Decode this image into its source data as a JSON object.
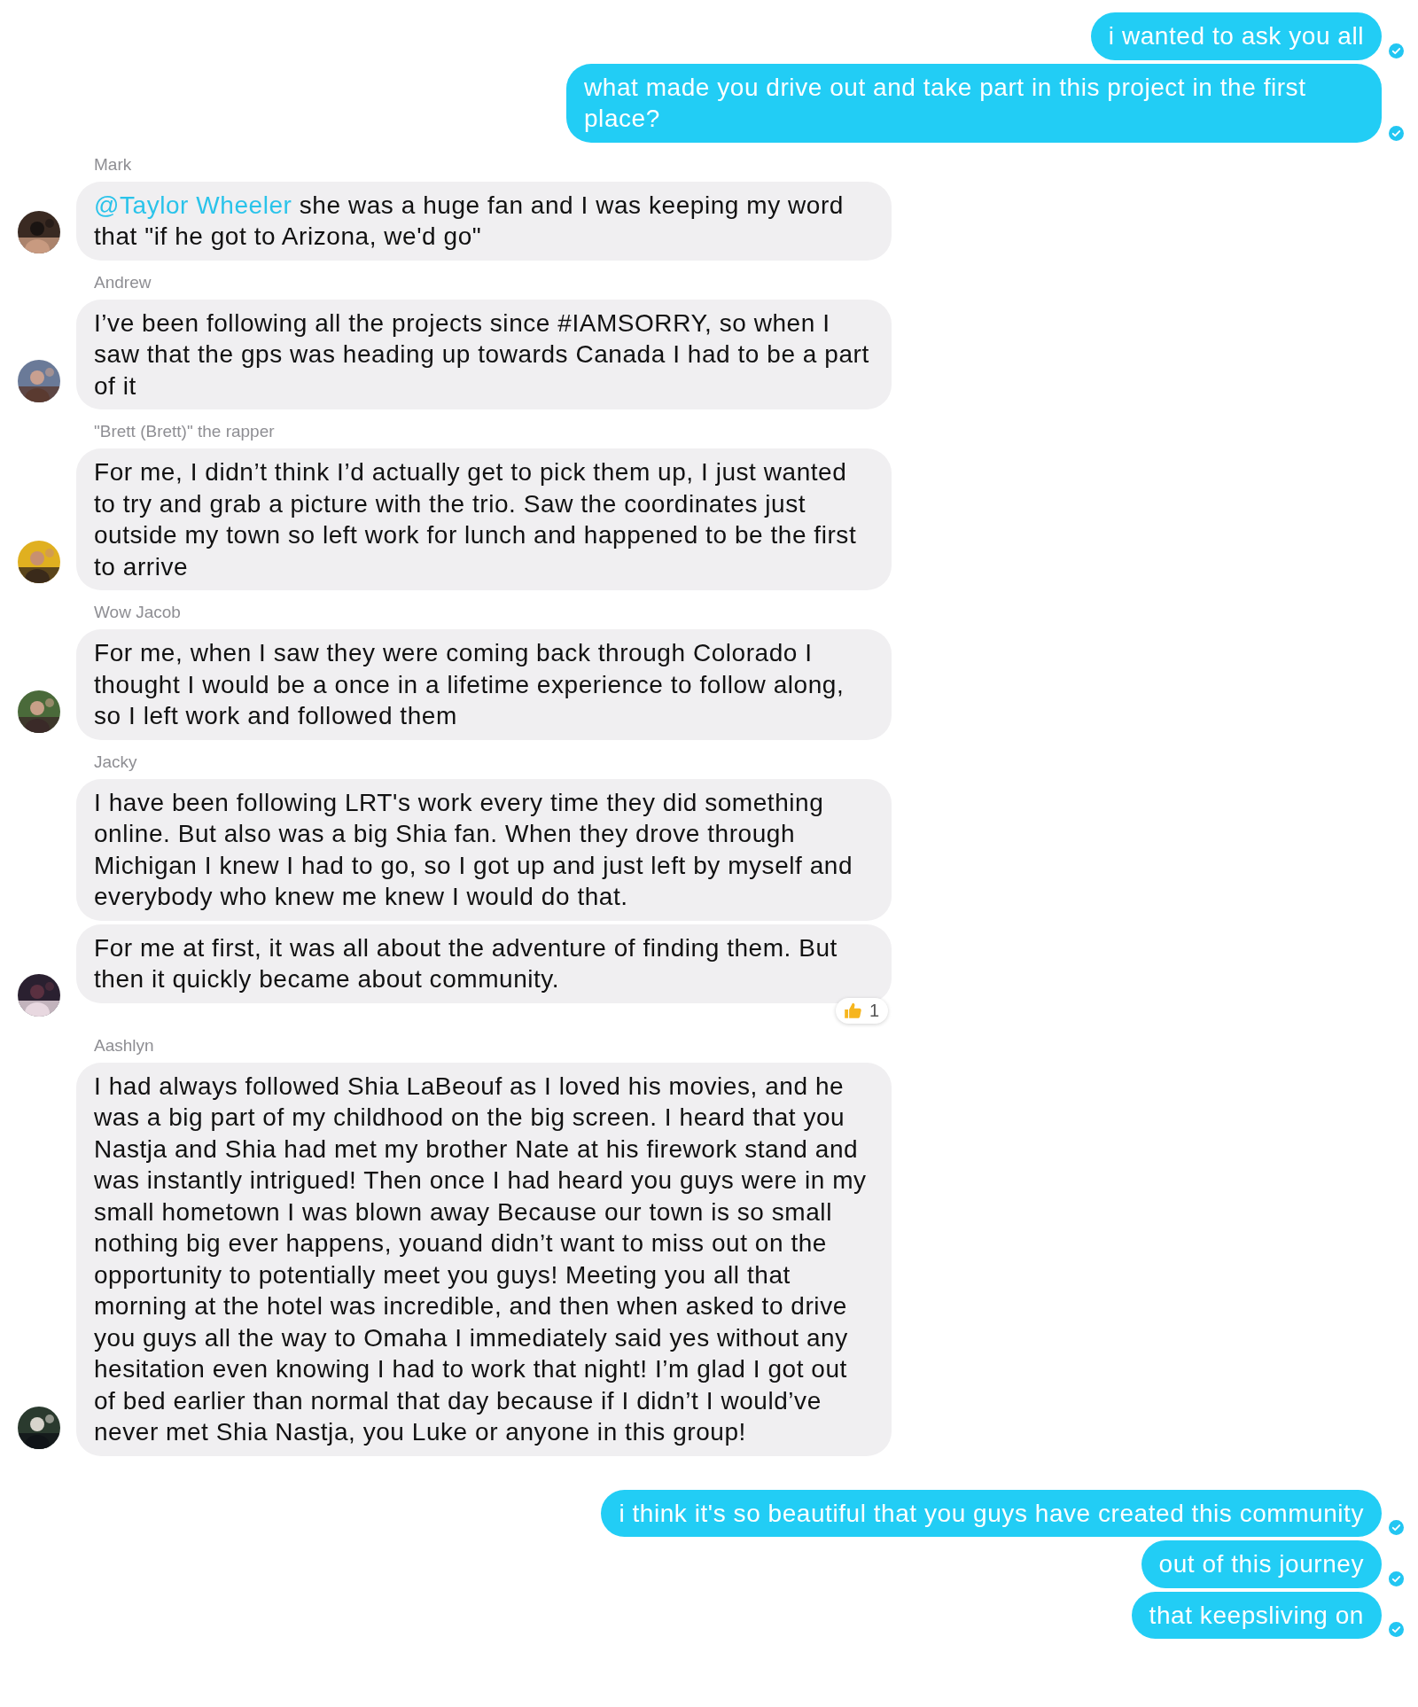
{
  "groups": [
    {
      "kind": "outgoing",
      "messages": [
        {
          "text": "i wanted to ask you all",
          "delivered": true
        },
        {
          "text": "what made you drive out and take part in this project in the first place?",
          "delivered": true
        }
      ]
    },
    {
      "kind": "incoming",
      "sender": "Mark",
      "avatar": {
        "kind": "picture"
      },
      "messages": [
        {
          "mention": "@Taylor Wheeler",
          "text": "she was a huge fan and I was keeping my word that \"if he got to Arizona, we'd go\""
        }
      ]
    },
    {
      "kind": "incoming",
      "sender": "Andrew",
      "avatar": {
        "kind": "picture"
      },
      "messages": [
        {
          "text": "I’ve been following all the projects since #IAMSORRY, so when I saw that the gps was heading up towards Canada I had to be a part of it"
        }
      ]
    },
    {
      "kind": "incoming",
      "sender": "\"Brett (Brett)\" the rapper",
      "avatar": {
        "kind": "picture"
      },
      "messages": [
        {
          "text": "For me, I didn’t think I’d actually get to pick them up, I just wanted to try and grab a picture with the trio. Saw the coordinates just outside my town so left work for lunch and happened to be the first to arrive"
        }
      ]
    },
    {
      "kind": "incoming",
      "sender": "Wow Jacob",
      "avatar": {
        "kind": "picture"
      },
      "messages": [
        {
          "text": "For me, when I saw they were coming back through Colorado I thought I would be a once in a lifetime experience to follow along, so I left work and followed them"
        }
      ]
    },
    {
      "kind": "incoming",
      "sender": "Jacky",
      "avatar": {
        "kind": "picture"
      },
      "messages": [
        {
          "text": "I have been following LRT's work every time they did something online. But also was a big Shia fan. When they drove through Michigan I knew I had to go, so I got up and just left by myself and everybody who knew me knew I would do that."
        },
        {
          "text": "For me at first, it was all about the adventure of finding them. But then it quickly became about community.",
          "reaction": {
            "count": "1"
          }
        }
      ]
    },
    {
      "kind": "incoming",
      "sender": "Aashlyn",
      "avatar": {
        "kind": "picture"
      },
      "messages": [
        {
          "text": "I had always followed Shia LaBeouf as I loved his movies, and he was a big part of my childhood on the big screen. I heard that you Nastja and Shia had met my brother Nate at his firework stand and was instantly intrigued! Then once I had heard you guys were in my small hometown I was blown away Because our town is so small nothing big ever happens, youand didn’t want to miss out on the opportunity to potentially meet you guys! Meeting you all that morning at the hotel was incredible, and then when asked to drive you guys all the way to Omaha I immediately said yes without any hesitation even knowing I had to work that night! I’m glad I got out of bed earlier than normal that day because if I didn’t I would’ve never met Shia Nastja, you Luke or anyone in this group!"
        }
      ]
    },
    {
      "kind": "outgoing",
      "messages": [
        {
          "text": "i think it's so beautiful that you guys have created this community",
          "delivered": true
        },
        {
          "text": "out of this journey",
          "delivered": true
        },
        {
          "text": "that keepsliving on",
          "delivered": true
        }
      ]
    }
  ]
}
